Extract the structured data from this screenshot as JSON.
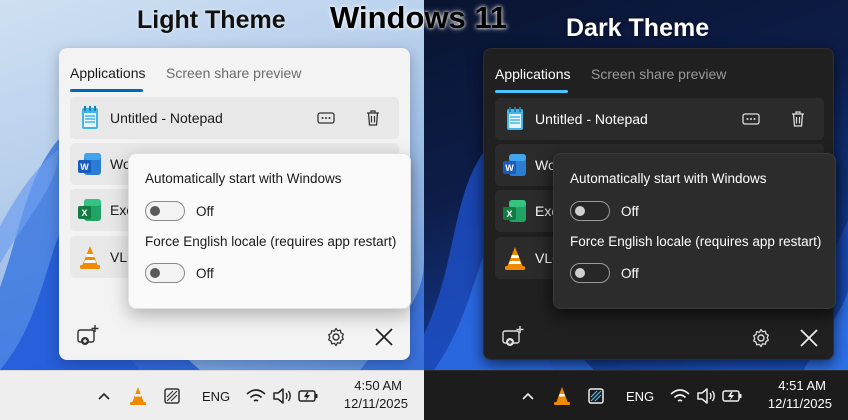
{
  "main_title": "Windows 11",
  "light": {
    "label": "Light Theme",
    "tabs": [
      {
        "label": "Applications"
      },
      {
        "label": "Screen share preview"
      }
    ],
    "apps": [
      {
        "name": "Untitled - Notepad"
      },
      {
        "name": "Wo"
      },
      {
        "name": "Exc"
      },
      {
        "name": "VLC"
      }
    ],
    "settings": {
      "opt1_label": "Automatically start with Windows",
      "opt1_state": "Off",
      "opt2_label": "Force English locale (requires app restart)",
      "opt2_state": "Off"
    },
    "taskbar": {
      "lang": "ENG",
      "time": "4:50 AM",
      "date": "12/11/2025"
    }
  },
  "dark": {
    "label": "Dark Theme",
    "tabs": [
      {
        "label": "Applications"
      },
      {
        "label": "Screen share preview"
      }
    ],
    "apps": [
      {
        "name": "Untitled - Notepad"
      },
      {
        "name": "Wo"
      },
      {
        "name": "Exc"
      },
      {
        "name": "VLC"
      }
    ],
    "settings": {
      "opt1_label": "Automatically start with Windows",
      "opt1_state": "Off",
      "opt2_label": "Force English locale (requires app restart)",
      "opt2_state": "Off"
    },
    "taskbar": {
      "lang": "ENG",
      "time": "4:51 AM",
      "date": "12/11/2025"
    }
  },
  "icons": {
    "tray": [
      "chevron-up-icon",
      "vlc-icon",
      "snipping-tool-icon",
      "wifi-icon",
      "volume-icon",
      "battery-icon"
    ],
    "row_actions": [
      "screen-share-icon",
      "trash-icon"
    ],
    "footer": [
      "add-window-icon",
      "gear-icon",
      "close-icon"
    ]
  },
  "colors": {
    "accent_light": "#0067c0",
    "accent_dark": "#4cc2ff"
  }
}
